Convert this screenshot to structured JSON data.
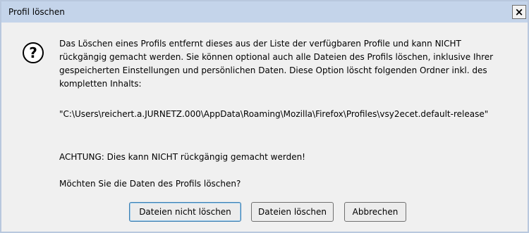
{
  "window": {
    "title": "Profil löschen",
    "close_glyph": "×"
  },
  "icon": {
    "name": "question-icon",
    "glyph": "?"
  },
  "message": {
    "paragraph1": "Das Löschen eines Profils entfernt dieses aus der Liste der verfügbaren Profile und kann NICHT rückgängig gemacht werden. Sie können optional auch alle Dateien des Profils löschen, inklusive Ihrer gespeicherten Einstellungen und persönlichen Daten. Diese Option löscht folgenden Ordner inkl. des kompletten Inhalts:",
    "path": "\"C:\\Users\\reichert.a.JURNETZ.000\\AppData\\Roaming\\Mozilla\\Firefox\\Profiles\\vsy2ecet.default-release\"",
    "warning": "ACHTUNG: Dies kann NICHT rückgängig gemacht werden!",
    "question": "Möchten Sie die Daten des Profils löschen?"
  },
  "buttons": {
    "keep_files": "Dateien nicht löschen",
    "delete_files": "Dateien löschen",
    "cancel": "Abbrechen"
  },
  "colors": {
    "titlebar": "#c4d4ea",
    "border": "#b9c8de",
    "body": "#f0f0f0",
    "default_button_border": "#3c7fb1"
  }
}
